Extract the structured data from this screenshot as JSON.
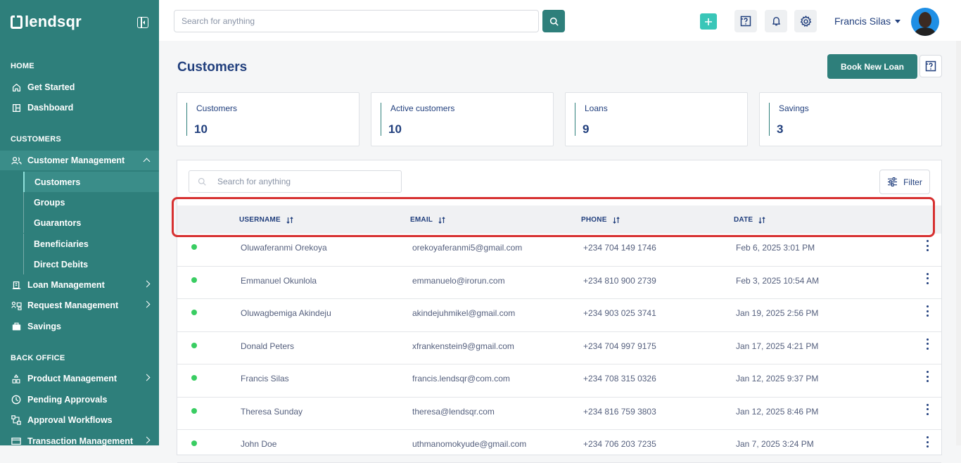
{
  "brand": {
    "name": "lendsqr"
  },
  "sidebar": {
    "sections": [
      "HOME",
      "CUSTOMERS",
      "BACK OFFICE"
    ],
    "home_items": [
      {
        "label": "Get Started",
        "icon": "home-icon"
      },
      {
        "label": "Dashboard",
        "icon": "dashboard-icon"
      }
    ],
    "customer_management": {
      "label": "Customer Management",
      "icon": "users-icon"
    },
    "customer_sub_items": [
      "Customers",
      "Groups",
      "Guarantors",
      "Beneficiaries",
      "Direct Debits"
    ],
    "other_items": [
      {
        "label": "Loan Management",
        "icon": "bank-icon"
      },
      {
        "label": "Request Management",
        "icon": "request-icon"
      },
      {
        "label": "Savings",
        "icon": "briefcase-icon"
      }
    ],
    "back_office_items": [
      {
        "label": "Product Management",
        "icon": "product-icon"
      },
      {
        "label": "Pending Approvals",
        "icon": "clock-icon"
      },
      {
        "label": "Approval Workflows",
        "icon": "workflow-icon"
      },
      {
        "label": "Transaction Management",
        "icon": "transaction-icon"
      }
    ]
  },
  "topbar": {
    "search_placeholder": "Search for anything",
    "user_name": "Francis Silas"
  },
  "page": {
    "title": "Customers",
    "book_button": "Book New Loan"
  },
  "stats": [
    {
      "label": "Customers",
      "value": "10"
    },
    {
      "label": "Active customers",
      "value": "10"
    },
    {
      "label": "Loans",
      "value": "9"
    },
    {
      "label": "Savings",
      "value": "3"
    }
  ],
  "table": {
    "search_placeholder": "Search for anything",
    "filter_label": "Filter",
    "columns": [
      "USERNAME",
      "EMAIL",
      "PHONE",
      "DATE"
    ],
    "rows": [
      {
        "username": "Oluwaferanmi Orekoya",
        "email": "orekoyaferanmi5@gmail.com",
        "phone": "+234 704 149 1746",
        "date": "Feb 6, 2025 3:01 PM"
      },
      {
        "username": "Emmanuel Okunlola",
        "email": "emmanuelo@irorun.com",
        "phone": "+234 810 900 2739",
        "date": "Feb 3, 2025 10:54 AM"
      },
      {
        "username": "Oluwagbemiga Akindeju",
        "email": "akindejuhmikel@gmail.com",
        "phone": "+234 903 025 3741",
        "date": "Jan 19, 2025 2:56 PM"
      },
      {
        "username": "Donald Peters",
        "email": "xfrankenstein9@gmail.com",
        "phone": "+234 704 997 9175",
        "date": "Jan 17, 2025 4:21 PM"
      },
      {
        "username": "Francis Silas",
        "email": "francis.lendsqr@com.com",
        "phone": "+234 708 315 0326",
        "date": "Jan 12, 2025 9:37 PM"
      },
      {
        "username": "Theresa Sunday",
        "email": "theresa@lendsqr.com",
        "phone": "+234 816 759 3803",
        "date": "Jan 12, 2025 8:46 PM"
      },
      {
        "username": "John Doe",
        "email": "uthmanomokyude@gmail.com",
        "phone": "+234 706 203 7235",
        "date": "Jan 7, 2025 3:24 PM"
      }
    ]
  }
}
